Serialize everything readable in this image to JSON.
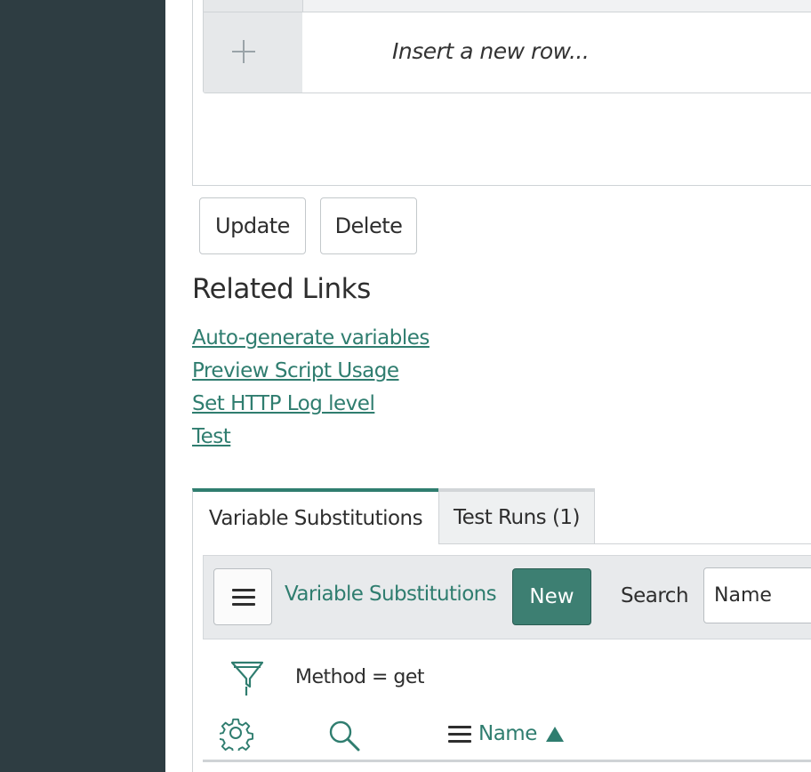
{
  "embedded_list": {
    "insert_placeholder": "Insert a new row..."
  },
  "form_buttons": {
    "update": "Update",
    "delete": "Delete"
  },
  "related_links": {
    "title": "Related Links",
    "links": [
      "Auto-generate variables",
      "Preview Script Usage",
      "Set HTTP Log level",
      "Test"
    ]
  },
  "tabs": [
    {
      "label": "Variable Substitutions",
      "active": true
    },
    {
      "label": "Test Runs (1)",
      "active": false
    }
  ],
  "list": {
    "title": "Variable Substitutions",
    "new_label": "New",
    "search_label": "Search",
    "search_field": "Name",
    "filter": "Method = get",
    "column": {
      "label": "Name",
      "sort": "ascending"
    }
  },
  "icons": [
    "hamburger-icon",
    "filter-funnel-icon",
    "gear-icon",
    "search-icon",
    "column-menu-icon",
    "sort-ascending-icon",
    "plus-icon"
  ],
  "colors": {
    "sidebar": "#2e3d42",
    "accent": "#2f7d6f",
    "new_button": "#3d7f72"
  }
}
